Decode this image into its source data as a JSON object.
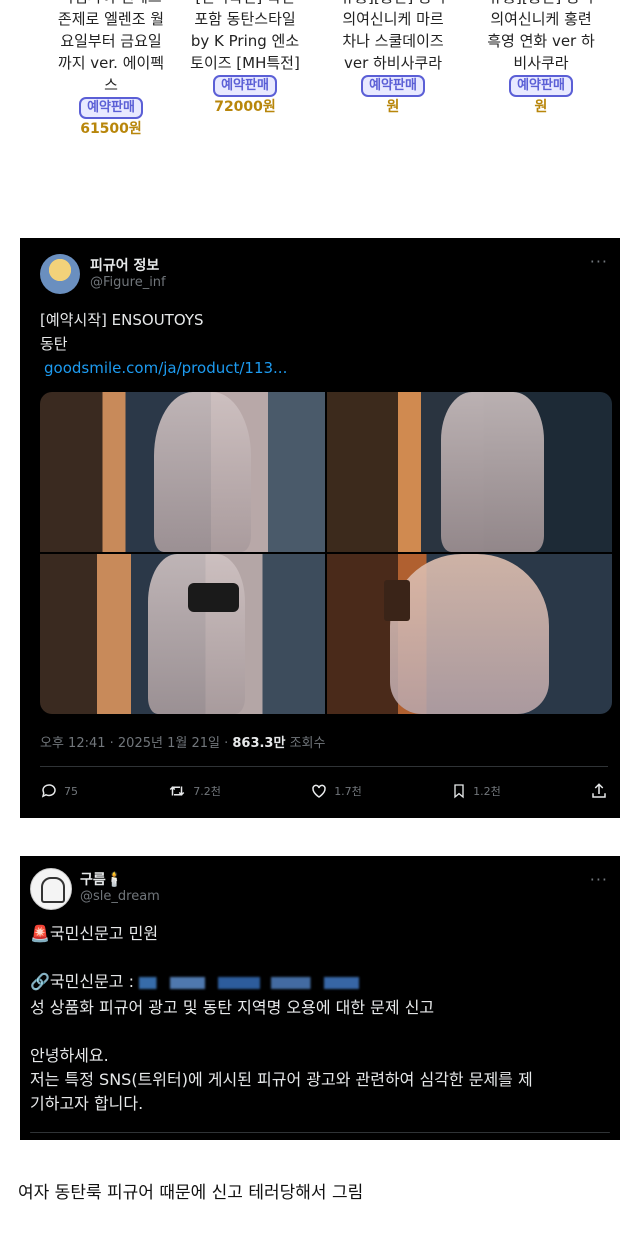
{
  "products": [
    {
      "name": "라임파이 젠레스\n존제로 엘렌조 월\n요일부터 금요일\n까지 ver. 에이펙\n스",
      "badge": "예약판매",
      "price": "61500원"
    },
    {
      "name": "[단독특전] 특전\n포함 동탄스타일\nby K Pring 엔소\n토이즈 [MH특전]",
      "badge": "예약판매",
      "price": "72000원"
    },
    {
      "name": "유통][총판] 승리\n의여신니케 마르\n차나 스쿨데이즈\nver 하비사쿠라",
      "badge": "예약판매",
      "price": "원"
    },
    {
      "name": "유통][총판] 승리\n의여신니케 홍련\n흑영 연화 ver 하\n비사쿠라",
      "badge": "예약판매",
      "price": "원"
    }
  ],
  "tweet1": {
    "display_name": "피규어 정보",
    "handle": "@Figure_inf",
    "more": "···",
    "text_line1": "[예약시작] ENSOUTOYS",
    "text_line2": "동탄",
    "link": "goodsmile.com/ja/product/113...",
    "time": "오후 12:41 · 2025년 1월 21일 · ",
    "views": "863.3만",
    "views_label": " 조회수",
    "replies": "75",
    "retweets": "7.2천",
    "likes": "1.7천",
    "bookmarks": "1.2천"
  },
  "tweet2": {
    "display_name": "구름🕯️",
    "handle": "@sle_dream",
    "more": "···",
    "line1": "🚨국민신문고 민원",
    "line2_label": "🔗국민신문고 : ",
    "line3": "성 상품화 피규어 광고 및 동탄 지역명 오용에 대한 문제 신고",
    "line4": "안녕하세요.",
    "line5": "저는 특정 SNS(트위터)에 게시된 피규어 광고와 관련하여 심각한 문제를 제",
    "line6": "기하고자 합니다."
  },
  "caption": "여자 동탄룩 피규어 때문에 신고 테러당해서 그림"
}
